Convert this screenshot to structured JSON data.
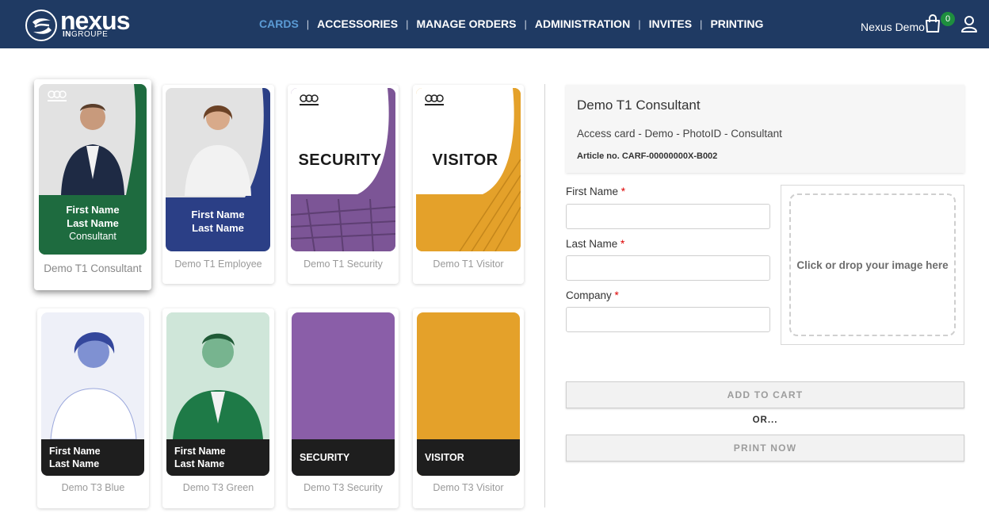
{
  "brand": {
    "name": "nexus",
    "sub_bold": "IN",
    "sub_normal": "GROUPE"
  },
  "nav": {
    "items": [
      {
        "label": "CARDS",
        "active": true
      },
      {
        "label": "ACCESSORIES",
        "active": false
      },
      {
        "label": "MANAGE ORDERS",
        "active": false
      },
      {
        "label": "ADMINISTRATION",
        "active": false
      },
      {
        "label": "INVITES",
        "active": false
      },
      {
        "label": "PRINTING",
        "active": false
      }
    ],
    "separator": "|"
  },
  "user": {
    "name": "Nexus Demo",
    "cart_count": "0",
    "icons": [
      "cart-icon",
      "user-icon"
    ]
  },
  "cards": {
    "consultant": {
      "label": "Demo T1 Consultant",
      "first": "First Name",
      "last": "Last Name",
      "role": "Consultant"
    },
    "employee": {
      "label": "Demo T1 Employee",
      "first": "First Name",
      "last": "Last Name"
    },
    "security": {
      "label": "Demo T1 Security",
      "word": "SECURITY"
    },
    "visitor": {
      "label": "Demo T1 Visitor",
      "word": "VISITOR"
    },
    "t3blue": {
      "label": "Demo T3 Blue",
      "first": "First Name",
      "last": "Last Name"
    },
    "t3green": {
      "label": "Demo T3 Green",
      "first": "First Name",
      "last": "Last Name"
    },
    "t3security": {
      "label": "Demo T3 Security",
      "word": "SECURITY"
    },
    "t3visitor": {
      "label": "Demo T3 Visitor",
      "word": "VISITOR"
    }
  },
  "colors": {
    "header": "#1f3a63",
    "green": "#1e6b3f",
    "blue": "#2b3f86",
    "purple": "#8a5ea8",
    "orange": "#e4a12a",
    "dark": "#1e1e1e"
  },
  "product": {
    "title": "Demo T1 Consultant",
    "description": "Access card - Demo - PhotoID - Consultant",
    "article": "Article no. CARF-00000000X-B002"
  },
  "form": {
    "first_name_label": "First Name",
    "last_name_label": "Last Name",
    "company_label": "Company",
    "required_mark": "*",
    "first_name_value": "",
    "last_name_value": "",
    "company_value": "",
    "dropzone_text": "Click or drop your image here"
  },
  "actions": {
    "add_to_cart": "ADD TO CART",
    "or": "OR...",
    "print_now": "PRINT NOW"
  }
}
